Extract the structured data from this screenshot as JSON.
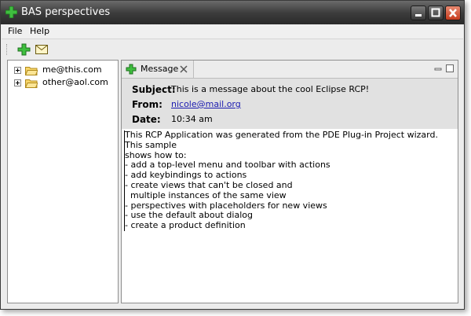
{
  "window": {
    "title": "BAS perspectives",
    "icon": "plus-icon"
  },
  "menu": {
    "items": [
      "File",
      "Help"
    ]
  },
  "toolbar": {
    "buttons": [
      {
        "icon": "add-icon"
      },
      {
        "icon": "mail-icon"
      }
    ]
  },
  "tree": {
    "items": [
      {
        "label": "me@this.com",
        "icon": "folder-icon"
      },
      {
        "label": "other@aol.com",
        "icon": "folder-icon"
      }
    ]
  },
  "message_view": {
    "tab_label": "Message",
    "subject_label": "Subject:",
    "subject": "This is a message about the cool Eclipse RCP!",
    "from_label": "From:",
    "from": "nicole@mail.org",
    "date_label": "Date:",
    "date": "10:34 am",
    "body": "This RCP Application was generated from the PDE Plug-in Project wizard. This sample\nshows how to:\n- add a top-level menu and toolbar with actions\n- add keybindings to actions\n- create views that can't be closed and\n  multiple instances of the same view\n- perspectives with placeholders for new views\n- use the default about dialog\n- create a product definition"
  },
  "colors": {
    "accent_green": "#2e9b2e",
    "close_button": "#c63a1c",
    "link": "#1a1ab0"
  }
}
